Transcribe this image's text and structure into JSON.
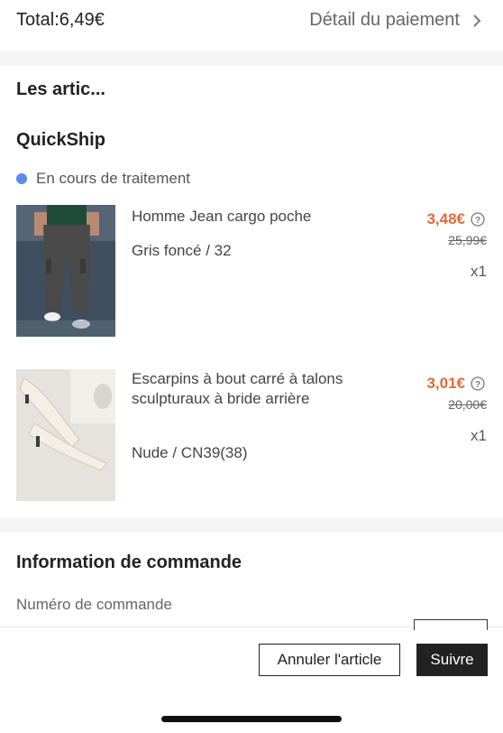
{
  "header": {
    "total": "Total:6,49€",
    "payment_detail": "Détail du paiement",
    "chevron_icon": "chevron-right-icon"
  },
  "items_section": {
    "title": "Les artic...",
    "shipping_label": "QuickShip",
    "status": "En cours de traitement",
    "status_color": "#5b8def"
  },
  "items": [
    {
      "name": "Homme Jean cargo poche",
      "variant": "Gris foncé / 32",
      "price": "3,48€",
      "original_price": "25,99€",
      "quantity": "x1"
    },
    {
      "name": "Escarpins à bout carré à talons sculpturaux à bride arrière",
      "variant": "Nude / CN39(38)",
      "price": "3,01€",
      "original_price": "20,00€",
      "quantity": "x1"
    }
  ],
  "order_info": {
    "title": "Information de commande",
    "order_number_label": "Numéro de commande"
  },
  "actions": {
    "cancel_label": "Annuler l'article",
    "track_label": "Suivre"
  },
  "colors": {
    "price": "#e06a3c",
    "primary_button": "#222222"
  }
}
